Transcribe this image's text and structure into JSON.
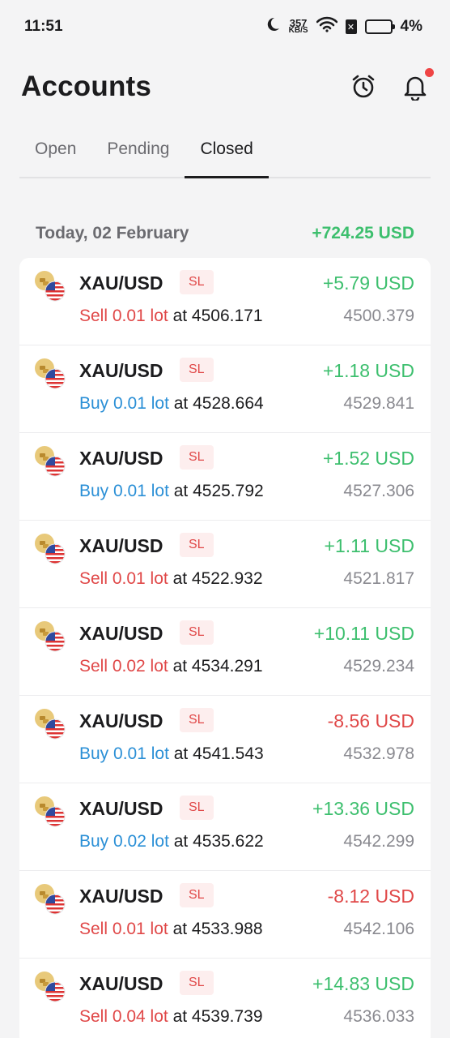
{
  "status_bar": {
    "time": "11:51",
    "net_speed_value": "357",
    "net_speed_unit": "KB/S",
    "battery": "4%"
  },
  "header": {
    "title": "Accounts"
  },
  "tabs": [
    {
      "label": "Open",
      "active": false
    },
    {
      "label": "Pending",
      "active": false
    },
    {
      "label": "Closed",
      "active": true
    }
  ],
  "group": {
    "date": "Today, 02 February",
    "total": "+724.25 USD"
  },
  "trades": [
    {
      "symbol": "XAU/USD",
      "badge": "SL",
      "side": "sell",
      "side_text": "Sell 0.01 lot",
      "at_text": " at 4506.171",
      "profit": "+5.79 USD",
      "profit_sign": "pos",
      "close": "4500.379"
    },
    {
      "symbol": "XAU/USD",
      "badge": "SL",
      "side": "buy",
      "side_text": "Buy 0.01 lot",
      "at_text": " at 4528.664",
      "profit": "+1.18 USD",
      "profit_sign": "pos",
      "close": "4529.841"
    },
    {
      "symbol": "XAU/USD",
      "badge": "SL",
      "side": "buy",
      "side_text": "Buy 0.01 lot",
      "at_text": " at 4525.792",
      "profit": "+1.52 USD",
      "profit_sign": "pos",
      "close": "4527.306"
    },
    {
      "symbol": "XAU/USD",
      "badge": "SL",
      "side": "sell",
      "side_text": "Sell 0.01 lot",
      "at_text": " at 4522.932",
      "profit": "+1.11 USD",
      "profit_sign": "pos",
      "close": "4521.817"
    },
    {
      "symbol": "XAU/USD",
      "badge": "SL",
      "side": "sell",
      "side_text": "Sell 0.02 lot",
      "at_text": " at 4534.291",
      "profit": "+10.11 USD",
      "profit_sign": "pos",
      "close": "4529.234"
    },
    {
      "symbol": "XAU/USD",
      "badge": "SL",
      "side": "buy",
      "side_text": "Buy 0.01 lot",
      "at_text": " at 4541.543",
      "profit": "-8.56 USD",
      "profit_sign": "neg",
      "close": "4532.978"
    },
    {
      "symbol": "XAU/USD",
      "badge": "SL",
      "side": "buy",
      "side_text": "Buy 0.02 lot",
      "at_text": " at 4535.622",
      "profit": "+13.36 USD",
      "profit_sign": "pos",
      "close": "4542.299"
    },
    {
      "symbol": "XAU/USD",
      "badge": "SL",
      "side": "sell",
      "side_text": "Sell 0.01 lot",
      "at_text": " at 4533.988",
      "profit": "-8.12 USD",
      "profit_sign": "neg",
      "close": "4542.106"
    },
    {
      "symbol": "XAU/USD",
      "badge": "SL",
      "side": "sell",
      "side_text": "Sell 0.04 lot",
      "at_text": " at 4539.739",
      "profit": "+14.83 USD",
      "profit_sign": "pos",
      "close": "4536.033"
    }
  ],
  "colors": {
    "profit_positive": "#3dbf6e",
    "profit_negative": "#e04848",
    "sell": "#e04848",
    "buy": "#2a8fd6",
    "badge_bg": "#fdeeee"
  },
  "icons": {
    "asset": "gold-usflag-icon",
    "alarm": "alarm-clock-icon",
    "notifications": "bell-icon"
  }
}
